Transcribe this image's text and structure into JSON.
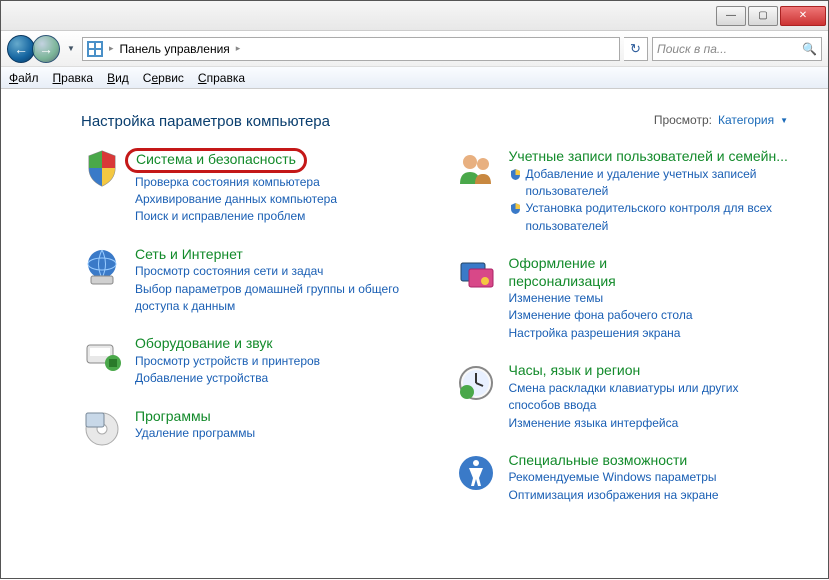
{
  "titlebar": {
    "minimize": "—",
    "maximize": "▢",
    "close": "✕"
  },
  "breadcrumb": {
    "root": "Панель управления"
  },
  "search": {
    "placeholder": "Поиск в па..."
  },
  "menu": {
    "file": "Файл",
    "edit": "Правка",
    "view": "Вид",
    "tools": "Сервис",
    "help": "Справка"
  },
  "heading": "Настройка параметров компьютера",
  "viewer": {
    "label": "Просмотр:",
    "value": "Категория"
  },
  "cats": {
    "system": {
      "title": "Система и безопасность",
      "links": [
        "Проверка состояния компьютера",
        "Архивирование данных компьютера",
        "Поиск и исправление проблем"
      ]
    },
    "network": {
      "title": "Сеть и Интернет",
      "links": [
        "Просмотр состояния сети и задач",
        "Выбор параметров домашней группы и общего доступа к данным"
      ]
    },
    "hardware": {
      "title": "Оборудование и звук",
      "links": [
        "Просмотр устройств и принтеров",
        "Добавление устройства"
      ]
    },
    "programs": {
      "title": "Программы",
      "links": [
        "Удаление программы"
      ]
    },
    "users": {
      "title": "Учетные записи пользователей и семейн...",
      "links": [
        "Добавление и удаление учетных записей пользователей",
        "Установка родительского контроля для всех пользователей"
      ]
    },
    "appearance": {
      "title": "Оформление и персонализация",
      "links": [
        "Изменение темы",
        "Изменение фона рабочего стола",
        "Настройка разрешения экрана"
      ]
    },
    "clock": {
      "title": "Часы, язык и регион",
      "links": [
        "Смена раскладки клавиатуры или других способов ввода",
        "Изменение языка интерфейса"
      ]
    },
    "ease": {
      "title": "Специальные возможности",
      "links": [
        "Рекомендуемые Windows параметры",
        "Оптимизация изображения на экране"
      ]
    }
  }
}
